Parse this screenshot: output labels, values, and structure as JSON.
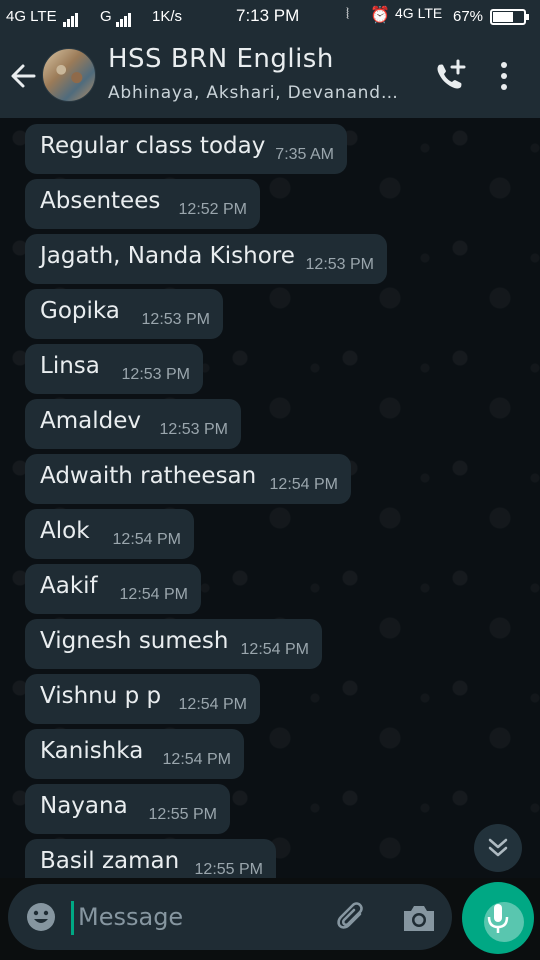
{
  "status_bar": {
    "network1": "4G LTE",
    "network2": "G",
    "speed": "1K/s",
    "time": "7:13 PM",
    "network3": "4G LTE",
    "battery": "67%",
    "battery_level": 0.67
  },
  "header": {
    "title": "HSS BRN English",
    "subtitle": "Abhinaya, Akshari, Devananda…"
  },
  "messages": [
    {
      "text": "Regular class today",
      "time": "7:35 AM"
    },
    {
      "text": "Absentees",
      "time": "12:52 PM"
    },
    {
      "text": "Jagath, Nanda Kishore",
      "time": "12:53 PM"
    },
    {
      "text": "Gopika",
      "time": "12:53 PM"
    },
    {
      "text": "Linsa",
      "time": "12:53 PM"
    },
    {
      "text": "Amaldev",
      "time": "12:53 PM"
    },
    {
      "text": "Adwaith ratheesan",
      "time": "12:54 PM"
    },
    {
      "text": "Alok",
      "time": "12:54 PM"
    },
    {
      "text": "Aakif",
      "time": "12:54 PM"
    },
    {
      "text": "Vignesh sumesh",
      "time": "12:54 PM"
    },
    {
      "text": "Vishnu p p",
      "time": "12:54 PM"
    },
    {
      "text": "Kanishka",
      "time": "12:54 PM"
    },
    {
      "text": "Nayana",
      "time": "12:55 PM"
    },
    {
      "text": "Basil zaman",
      "time": "12:55 PM"
    }
  ],
  "input": {
    "placeholder": "Message"
  },
  "colors": {
    "accent": "#00a884",
    "bubble": "#1f2c34",
    "header": "#1f2c34"
  },
  "icons": {
    "back": "arrow-left-icon",
    "call": "add-call-icon",
    "menu": "more-vert-icon",
    "emoji": "emoji-icon",
    "attach": "paperclip-icon",
    "camera": "camera-icon",
    "mic": "mic-icon",
    "scroll": "double-chevron-down-icon"
  }
}
